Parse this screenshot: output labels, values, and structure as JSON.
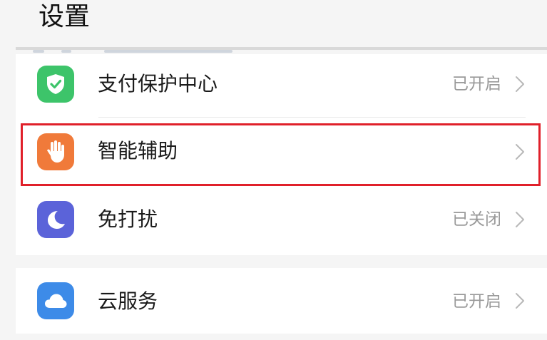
{
  "header": {
    "title": "设置"
  },
  "items": [
    {
      "label": "支付保护中心",
      "status": "已开启",
      "icon": "shield-check-icon",
      "icon_color": "#3dc46a"
    },
    {
      "label": "智能辅助",
      "status": "",
      "icon": "hand-icon",
      "icon_color": "#f07a3a"
    },
    {
      "label": "免打扰",
      "status": "已关闭",
      "icon": "moon-icon",
      "icon_color": "#5b63d9"
    },
    {
      "label": "云服务",
      "status": "已开启",
      "icon": "cloud-icon",
      "icon_color": "#3d8be8"
    }
  ],
  "highlight_color": "#e0202a"
}
